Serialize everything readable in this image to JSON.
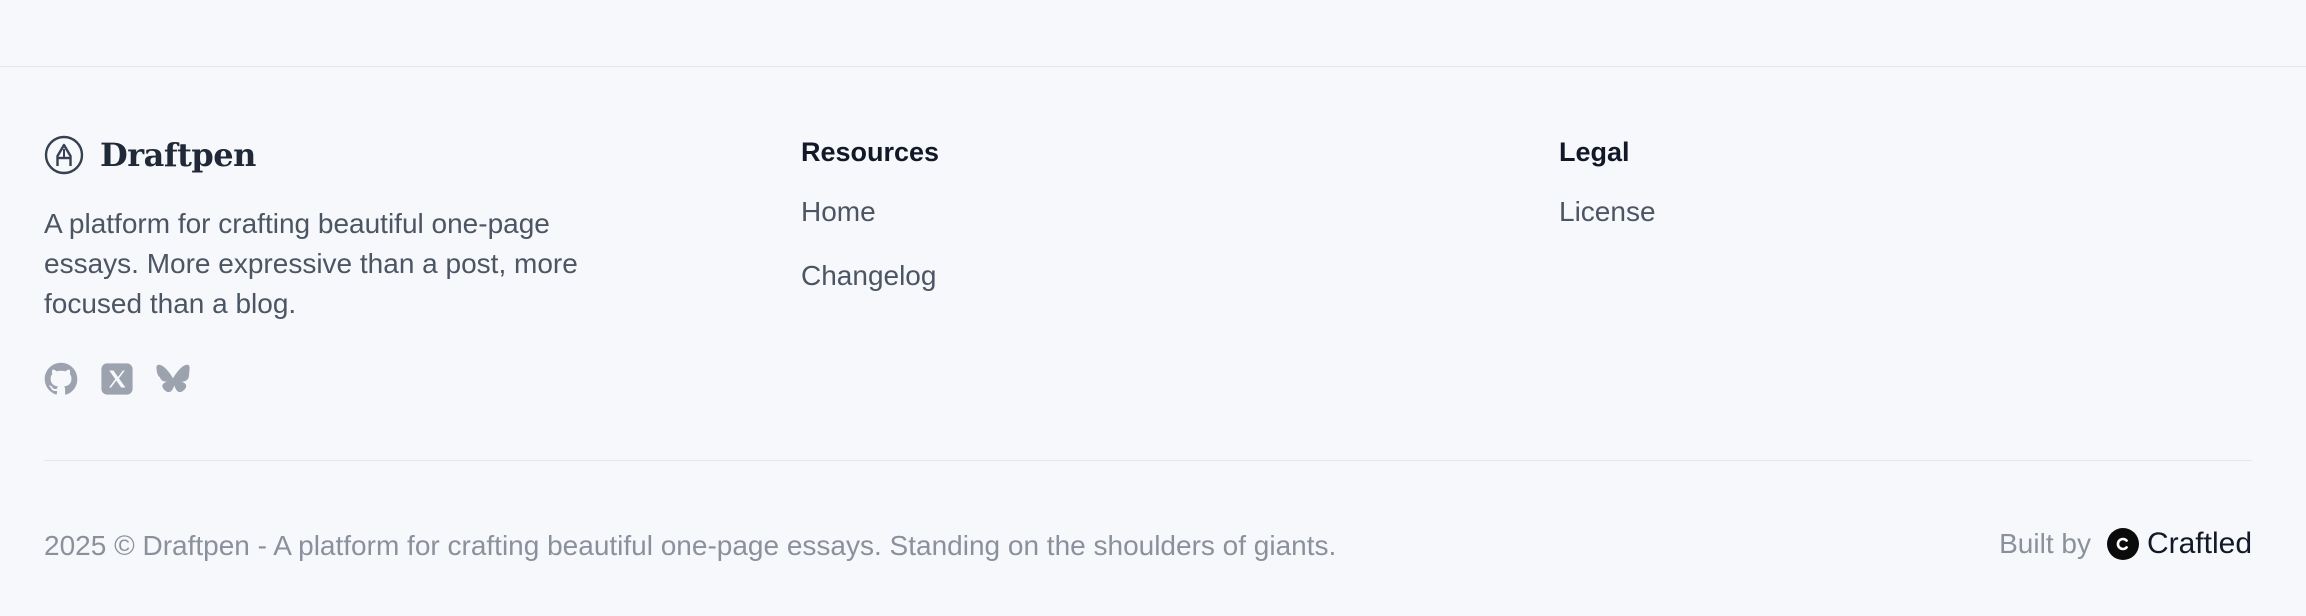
{
  "brand": {
    "name": "Draftpen",
    "logo_icon": "pen-nib-circle-icon",
    "tagline": "A platform for crafting beautiful one-page essays. More expressive than a post, more focused than a blog."
  },
  "social": [
    {
      "icon": "github-icon"
    },
    {
      "icon": "x-icon"
    },
    {
      "icon": "bluesky-icon"
    }
  ],
  "resources": {
    "title": "Resources",
    "links": [
      "Home",
      "Changelog"
    ]
  },
  "legal": {
    "title": "Legal",
    "links": [
      "License"
    ]
  },
  "footer": {
    "copyright": "2025 © Draftpen - A platform for crafting beautiful one-page essays. Standing on the shoulders of giants.",
    "built_by_label": "Built by",
    "builder_name": "Craftled",
    "builder_logo": "craftled-logo-icon"
  },
  "colors": {
    "background": "#f7f8fb",
    "text_primary": "#111827",
    "text_secondary": "#4b5563",
    "text_muted": "#8b919c",
    "divider": "#e3e5ea"
  }
}
